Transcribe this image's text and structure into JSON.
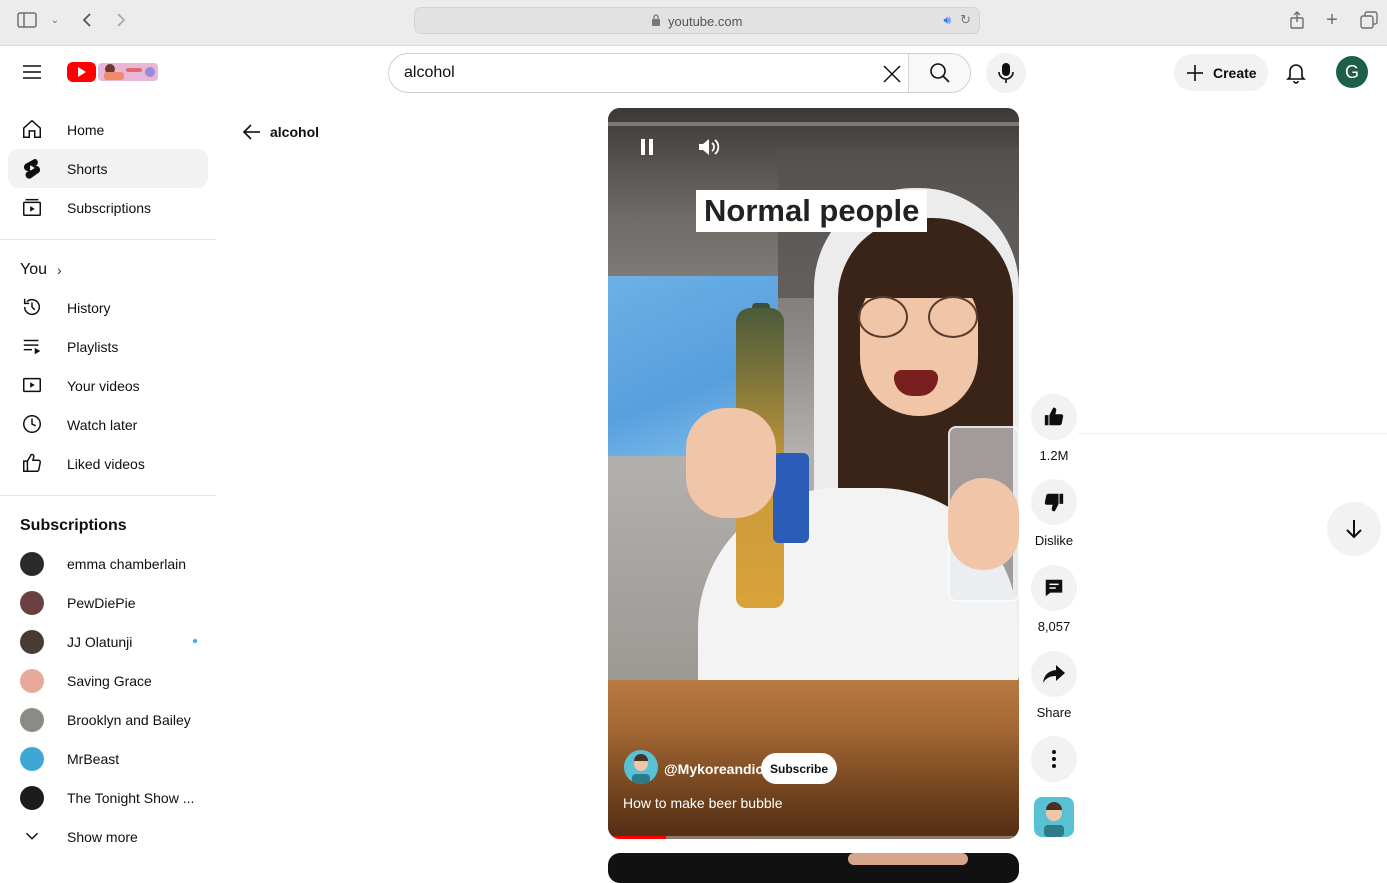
{
  "browser": {
    "url": "youtube.com"
  },
  "header": {
    "search_value": "alcohol",
    "create_label": "Create",
    "avatar_letter": "G"
  },
  "sidebar": {
    "main": [
      {
        "label": "Home",
        "icon": "home-icon"
      },
      {
        "label": "Shorts",
        "icon": "shorts-icon",
        "active": true
      },
      {
        "label": "Subscriptions",
        "icon": "subscriptions-icon"
      }
    ],
    "you_label": "You",
    "you_items": [
      {
        "label": "History",
        "icon": "history-icon"
      },
      {
        "label": "Playlists",
        "icon": "playlists-icon"
      },
      {
        "label": "Your videos",
        "icon": "your-videos-icon"
      },
      {
        "label": "Watch later",
        "icon": "watch-later-icon"
      },
      {
        "label": "Liked videos",
        "icon": "liked-videos-icon"
      }
    ],
    "subscriptions_label": "Subscriptions",
    "subscriptions": [
      {
        "label": "emma chamberlain",
        "color": "#2b2b2b"
      },
      {
        "label": "PewDiePie",
        "color": "#6b4040"
      },
      {
        "label": "JJ Olatunji",
        "color": "#4a3a36",
        "new": true
      },
      {
        "label": "Saving Grace",
        "color": "#e6a99a"
      },
      {
        "label": "Brooklyn and Bailey",
        "color": "#8c8a85"
      },
      {
        "label": "MrBeast",
        "color": "#3fa7d6"
      },
      {
        "label": "The Tonight Show ...",
        "color": "#1b1b1b"
      }
    ],
    "show_more": "Show more"
  },
  "query": {
    "back_label": "alcohol"
  },
  "short": {
    "caption": "Normal people",
    "channel": "@Mykoreandic",
    "subscribe": "Subscribe",
    "title": "How to make beer bubble",
    "progress": 0.14
  },
  "actions": {
    "likes": "1.2M",
    "dislike": "Dislike",
    "comments": "8,057",
    "share": "Share"
  },
  "colors": {
    "brand_red": "#ff0000",
    "accent_blue": "#3ea6ff"
  }
}
